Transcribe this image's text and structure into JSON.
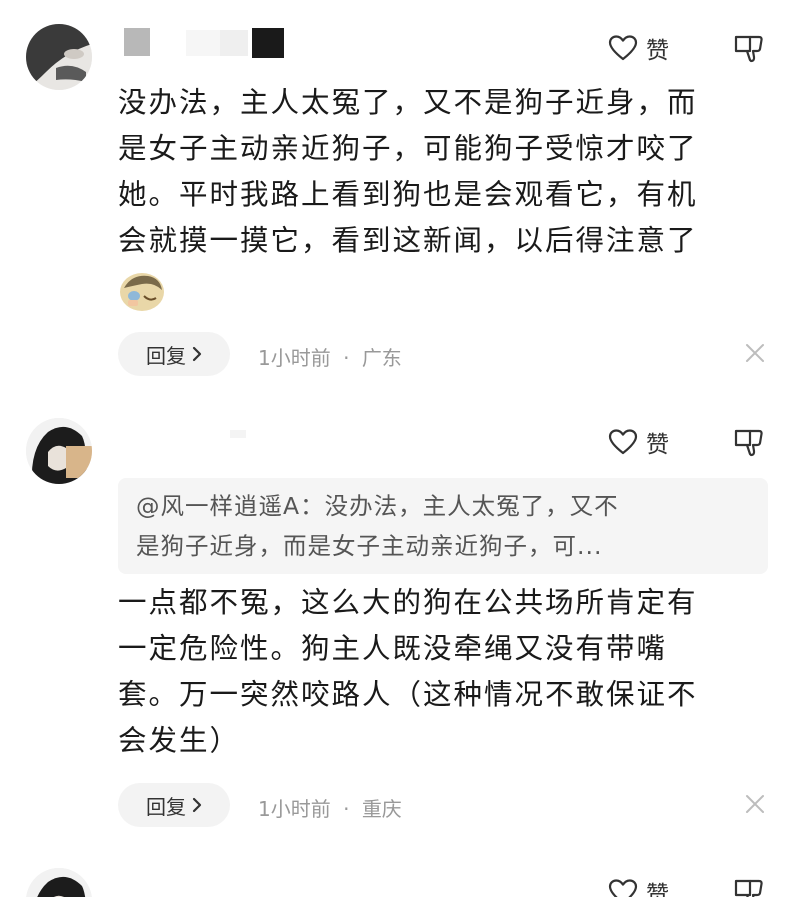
{
  "comments": [
    {
      "like_label": "赞",
      "lines": [
        "没办法，主人太冤了，又不是狗子近身，而",
        "是女子主动亲近狗子，可能狗子受惊才咬了",
        "她。平时我路上看到狗也是会观看它，有机",
        "会就摸一摸它，看到这新闻，以后得注意了"
      ],
      "reply_label": "回复",
      "time": "1小时前",
      "separator": "·",
      "location": "广东"
    },
    {
      "like_label": "赞",
      "quote_lines": [
        "@风一样逍遥A：没办法，主人太冤了，又不",
        "是狗子近身，而是女子主动亲近狗子，可..."
      ],
      "lines": [
        "一点都不冤，这么大的狗在公共场所肯定有",
        "一定危险性。狗主人既没牵绳又没有带嘴",
        "套。万一突然咬路人（这种情况不敢保证不",
        "会发生）"
      ],
      "reply_label": "回复",
      "time": "1小时前",
      "separator": "·",
      "location": "重庆"
    },
    {
      "like_label": "赞"
    }
  ],
  "icons": {
    "like": "heart-outline-icon",
    "dislike": "thumbs-down-icon",
    "close": "close-x-icon",
    "reply_chevron": "chevron-right-icon"
  },
  "colors": {
    "text": "#1a1a1a",
    "meta": "#999999",
    "quote_bg": "#f5f5f5",
    "pill_bg": "#f3f3f3"
  }
}
